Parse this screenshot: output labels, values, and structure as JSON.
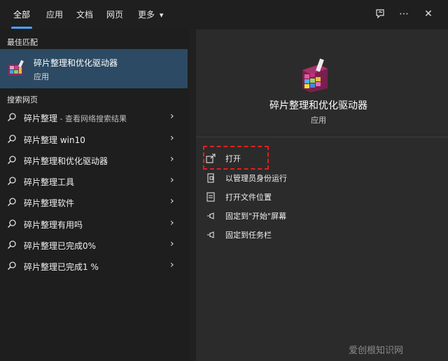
{
  "tabs": [
    {
      "label": "全部"
    },
    {
      "label": "应用"
    },
    {
      "label": "文档"
    },
    {
      "label": "网页"
    },
    {
      "label": "更多"
    }
  ],
  "more_caret": "▾",
  "toolbar": {
    "feedback_icon": "feedback-icon",
    "more_icon": "⋯",
    "close_icon": "✕"
  },
  "left": {
    "best_match_title": "最佳匹配",
    "best_match": {
      "title": "碎片整理和优化驱动器",
      "subtitle": "应用"
    },
    "web_search_title": "搜索网页",
    "results": [
      {
        "text": "碎片整理",
        "suffix": " - 查看网络搜索结果"
      },
      {
        "text": "碎片整理 win10",
        "suffix": ""
      },
      {
        "text": "碎片整理和优化驱动器",
        "suffix": ""
      },
      {
        "text": "碎片整理工具",
        "suffix": ""
      },
      {
        "text": "碎片整理软件",
        "suffix": ""
      },
      {
        "text": "碎片整理有用吗",
        "suffix": ""
      },
      {
        "text": "碎片整理已完成0%",
        "suffix": ""
      },
      {
        "text": "碎片整理已完成1 %",
        "suffix": ""
      }
    ]
  },
  "right": {
    "app_title": "碎片整理和优化驱动器",
    "app_subtitle": "应用",
    "actions": [
      {
        "label": "打开"
      },
      {
        "label": "以管理员身份运行"
      },
      {
        "label": "打开文件位置"
      },
      {
        "label": "固定到\"开始\"屏幕"
      },
      {
        "label": "固定到任务栏"
      }
    ]
  },
  "watermark": "爱创根知识网",
  "colors": {
    "accent": "#4aa3ff",
    "selected": "#2c4a63",
    "highlight_box": "#e02020"
  }
}
